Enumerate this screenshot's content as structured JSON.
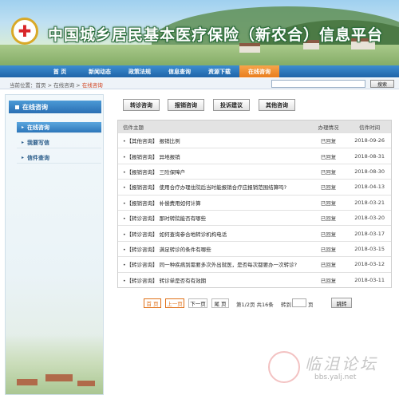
{
  "header": {
    "site_title": "中国城乡居民基本医疗保险（新农合）信息平台",
    "emblem_icon": "red-cross-emblem-icon"
  },
  "nav": {
    "items": [
      "首 页",
      "新闻动态",
      "政策法规",
      "信息查询",
      "资源下载",
      "在线咨询"
    ],
    "active_index": 5
  },
  "breadcrumb": {
    "prefix": "当前位置：",
    "home": "首页",
    "sep1": " > ",
    "section": "在线咨询",
    "sep2": " > ",
    "current": "在线咨询"
  },
  "search": {
    "value": "",
    "button_label": "搜索"
  },
  "sidebar": {
    "heading": "在线咨询",
    "items": [
      {
        "label": "在线咨询",
        "active": true
      },
      {
        "label": "我要写信",
        "active": false
      },
      {
        "label": "信件查询",
        "active": false
      }
    ]
  },
  "consult_tabs": [
    "转诊咨询",
    "报销咨询",
    "投诉建议",
    "其他咨询"
  ],
  "table": {
    "headers": {
      "title": "信件主题",
      "status": "办理情况",
      "date": "信件时间"
    },
    "rows": [
      {
        "title": "【其他咨询】 报销比例",
        "status": "已回复",
        "date": "2018-09-26"
      },
      {
        "title": "【报销咨询】 异地报销",
        "status": "已回复",
        "date": "2018-08-31"
      },
      {
        "title": "【报销咨询】 三险保障户",
        "status": "已回复",
        "date": "2018-08-30"
      },
      {
        "title": "【报销咨询】 使用合疗办理住院后当时能报销合疗应报销范围结算吗?",
        "status": "已回复",
        "date": "2018-04-13"
      },
      {
        "title": "【报销咨询】 补偿费用如何计算",
        "status": "已回复",
        "date": "2018-03-21"
      },
      {
        "title": "【转诊咨询】 那时转院能否有哪些",
        "status": "已回复",
        "date": "2018-03-20"
      },
      {
        "title": "【转诊咨询】 如何查询参合地转诊机构电话",
        "status": "已回复",
        "date": "2018-03-17"
      },
      {
        "title": "【转诊咨询】 满足转诊的条件有哪些",
        "status": "已回复",
        "date": "2018-03-15"
      },
      {
        "title": "【转诊咨询】 同一种疾病到需要多次外出就医，是否每次都要办一次转诊?",
        "status": "已回复",
        "date": "2018-03-12"
      },
      {
        "title": "【转诊咨询】 转诊单是否有有效期",
        "status": "已回复",
        "date": "2018-03-11"
      }
    ]
  },
  "pagination": {
    "first": "首 页",
    "prev": "上一页",
    "next": "下一页",
    "last": "尾 页",
    "page_info": "第1/2页 共16条",
    "goto_label": "转到",
    "goto_suffix": "页",
    "goto_value": "",
    "go_button": "跳转"
  },
  "watermark": {
    "text": "临沮论坛",
    "url": "bbs.yalj.net"
  }
}
